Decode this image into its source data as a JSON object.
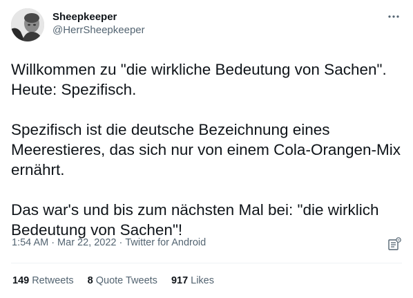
{
  "author": {
    "display_name": "Sheepkeeper",
    "handle": "@HerrSheepkeeper",
    "avatar_icon": "user-avatar"
  },
  "tweet": {
    "paragraphs": [
      "Willkommen zu \"die wirkliche Bedeutung von Sachen\". Heute: Spezifisch.",
      "Spezifisch ist die deutsche Bezeichnung eines Meerestieres, das sich nur von einem Cola-Orangen-Mix ernährt.",
      "Das war's und bis zum nächsten Mal bei: \"die wirklich Bedeutung von Sachen\"!"
    ],
    "time": "1:54 AM",
    "date": "Mar 22, 2022",
    "source": "Twitter for Android",
    "separator": "·"
  },
  "stats": {
    "retweets_count": "149",
    "retweets_label": "Retweets",
    "quotes_count": "8",
    "quotes_label": "Quote Tweets",
    "likes_count": "917",
    "likes_label": "Likes"
  },
  "icons": {
    "more": "more-horizontal-icon",
    "analytics": "analytics-icon"
  },
  "colors": {
    "text": "#0f1419",
    "secondary": "#536471",
    "divider": "#eff3f4"
  }
}
